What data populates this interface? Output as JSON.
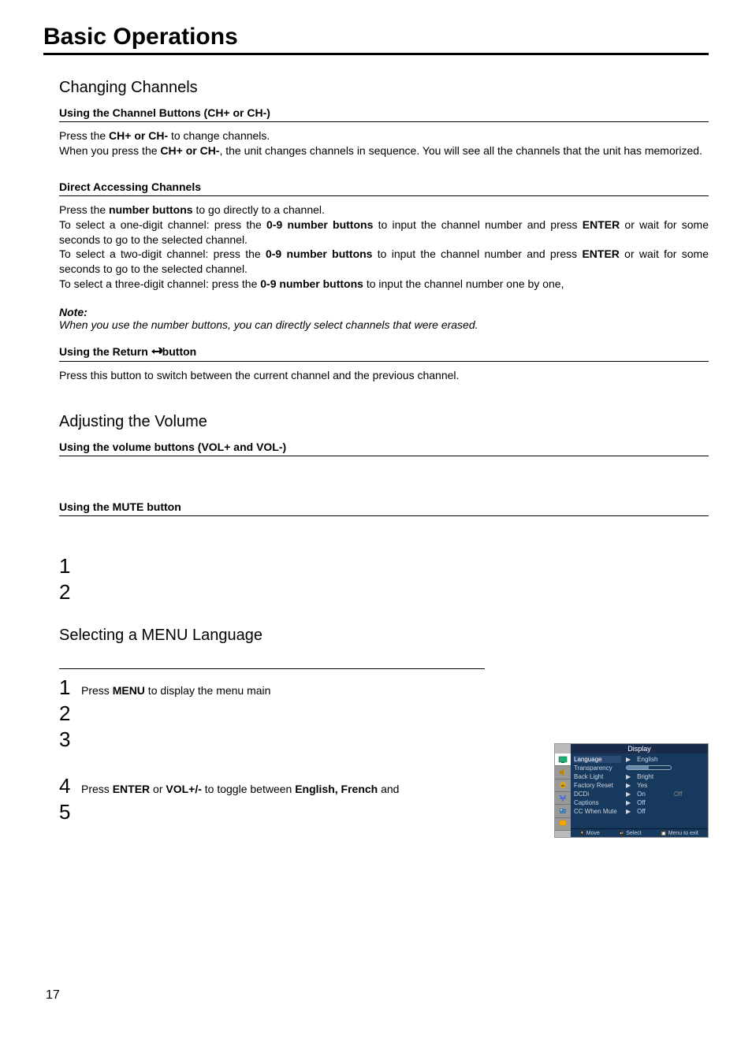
{
  "title": "Basic Operations",
  "sections": {
    "changing": {
      "heading": "Changing Channels",
      "sub1": "Using the Channel Buttons (CH+ or CH-)",
      "body1a": "Press the ",
      "body1b": "CH+ or CH-",
      "body1c": "  to change channels.",
      "body1d": "When you press the ",
      "body1e": "CH+ or CH-",
      "body1f": ", the unit changes channels in sequence. You will see all the channels that the unit has memorized.",
      "sub2": "Direct Accessing Channels",
      "body2a": "Press the ",
      "body2b": "number buttons",
      "body2c": " to go directly to a channel.",
      "body2d": "To select a one-digit channel: press the ",
      "body2e": "0-9 number buttons",
      "body2f": " to input the channel number and press ",
      "body2g": "ENTER",
      "body2h": " or wait for some seconds to go to the selected channel.",
      "body2i": "To select a two-digit channel: press the ",
      "body2j": "0-9 number buttons",
      "body2k": " to input the channel number and press ",
      "body2l": "ENTER",
      "body2m": " or wait for some seconds to go to the selected channel.",
      "body2n": "To select a three-digit channel:  press the ",
      "body2o": "0-9 number buttons",
      "body2p": " to input the channel number one by one,",
      "note_head": "Note:",
      "note_body": "When you use the number buttons, you can directly select channels  that  were erased.",
      "sub3a": "Using the Return   ",
      "sub3b": "button",
      "body3": "Press this button to switch between the current channel and the  previous channel."
    },
    "volume": {
      "heading": "Adjusting the Volume",
      "sub1": "Using the volume buttons (VOL+ and VOL-)",
      "sub2": "Using the MUTE button",
      "n1": "1",
      "n2": "2"
    },
    "menu": {
      "heading": "Selecting a MENU Language",
      "s1n": "1",
      "s1a": "Press  ",
      "s1b": "MENU",
      "s1c": " to display the menu main",
      "s2n": "2",
      "s3n": "3",
      "s4n": "4",
      "s4a": "Press ",
      "s4b": "ENTER",
      "s4c": " or ",
      "s4d": "VOL+/-",
      "s4e": " to toggle between ",
      "s4f": "English, French",
      "s4g": " and",
      "s5n": "5"
    }
  },
  "osd": {
    "title": "Display",
    "rows": [
      {
        "label": "Language",
        "val": "English"
      },
      {
        "label": "Transparency",
        "val": ""
      },
      {
        "label": "Back Light",
        "val": "Bright"
      },
      {
        "label": "Factory Reset",
        "val": "Yes"
      },
      {
        "label": "DCDi",
        "val": "On",
        "off": "Off"
      },
      {
        "label": "Captions",
        "val": "Off"
      },
      {
        "label": "CC When Mute",
        "val": "Off"
      }
    ],
    "footer": {
      "move": "Move",
      "select": "Select",
      "exit": "Menu to exit"
    }
  },
  "page": "17"
}
